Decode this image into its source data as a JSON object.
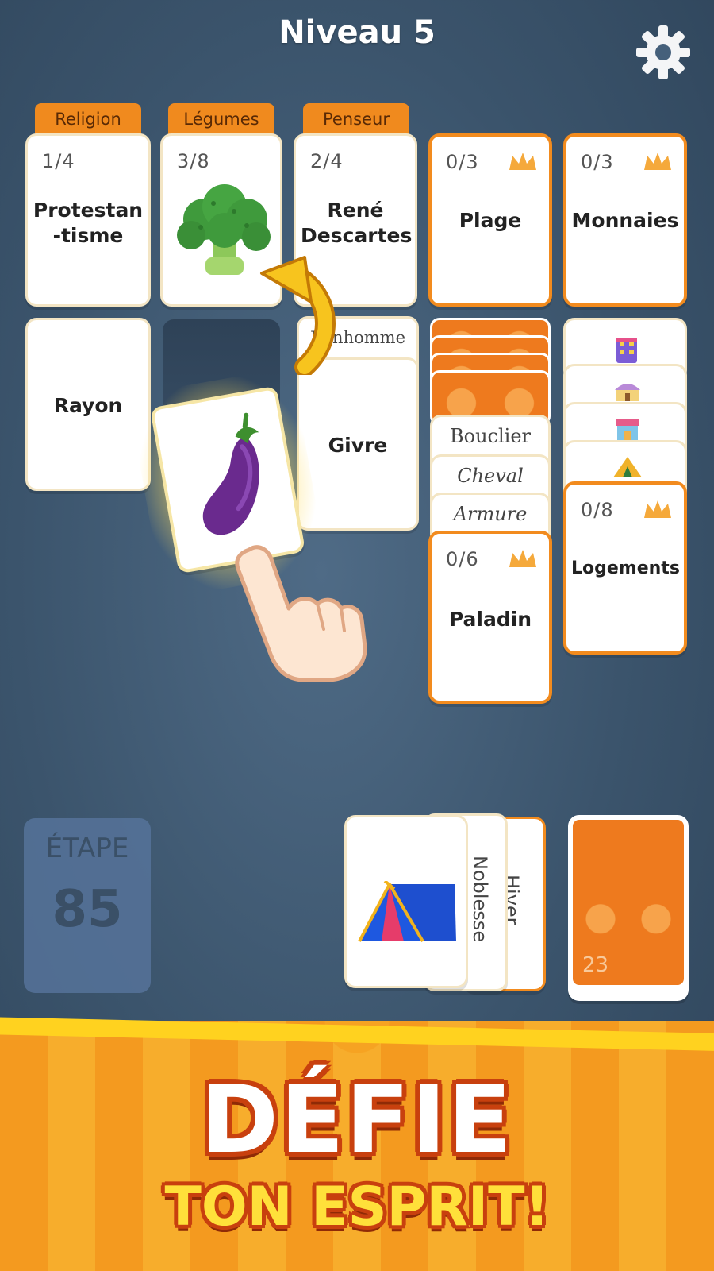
{
  "header": {
    "level_title": "Niveau 5",
    "settings_icon": "gear-icon"
  },
  "top_row": [
    {
      "tab": "Religion",
      "count": "1/4",
      "word_line1": "Protestan",
      "word_line2": "-tisme"
    },
    {
      "tab": "Légumes",
      "count": "3/8",
      "image": "broccoli-image"
    },
    {
      "tab": "Penseur",
      "count": "2/4",
      "word_line1": "René",
      "word_line2": "Descartes"
    },
    {
      "count": "0/3",
      "word": "Plage",
      "icon": "crown-icon"
    },
    {
      "count": "0/3",
      "word": "Monnaies",
      "icon": "crown-icon"
    }
  ],
  "second_row": {
    "rayon": "Rayon",
    "bonhomme": "Bonhomme",
    "givre": "Givre",
    "dragged_card_image": "eggplant-image",
    "stack4": {
      "labels": [
        "Bouclier",
        "Cheval",
        "Armure"
      ],
      "count": "0/6",
      "word": "Paladin"
    },
    "stack5": {
      "count": "0/8",
      "word": "Logements",
      "icons": [
        "building-icon",
        "yurt-icon",
        "shop-icon",
        "tent-icon"
      ]
    }
  },
  "etape": {
    "label": "ÉTAPE",
    "value": "85"
  },
  "hand": {
    "top_card_image": "tent-image",
    "labels": [
      "Noblesse",
      "Hiver"
    ]
  },
  "deck": {
    "count": "23"
  },
  "banner": {
    "title": "DÉFIE",
    "subtitle": "TON ESPRIT!"
  },
  "colors": {
    "accent": "#f28b1e",
    "background": "#3b546c",
    "banner_yellow": "#ffd21f"
  }
}
